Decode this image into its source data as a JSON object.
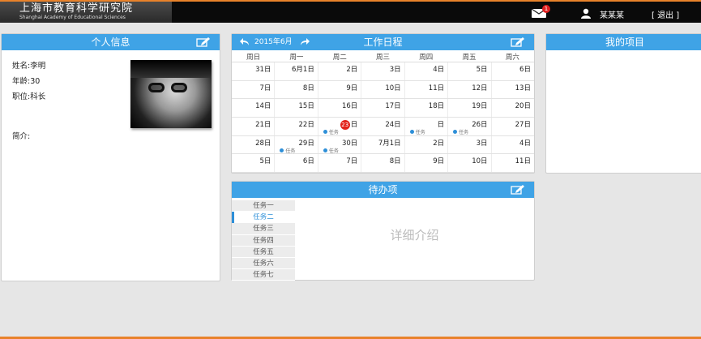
{
  "header": {
    "logo_cn": "上海市教育科学研究院",
    "logo_en": "Shanghai Academy of Educational Sciences",
    "mail_count": "1",
    "user_name": "某某某",
    "logout": "[ 退出 ]"
  },
  "info": {
    "title": "个人信息",
    "name": "姓名:李明",
    "age": "年龄:30",
    "position": "职位:科长",
    "intro": "简介:"
  },
  "calendar": {
    "title": "工作日程",
    "month": "2015年6月",
    "weekdays": [
      "周日",
      "周一",
      "周二",
      "周三",
      "周四",
      "周五",
      "周六"
    ],
    "rows": [
      [
        "31日",
        "6月1日",
        "2日",
        "3日",
        "4日",
        "5日",
        "6日"
      ],
      [
        "7日",
        "8日",
        "9日",
        "10日",
        "11日",
        "12日",
        "13日"
      ],
      [
        "14日",
        "15日",
        "16日",
        "17日",
        "18日",
        "19日",
        "20日"
      ],
      [
        "21日",
        "22日",
        "日",
        "24日",
        "日",
        "26日",
        "27日"
      ],
      [
        "28日",
        "29日",
        "30日",
        "7月1日",
        "2日",
        "3日",
        "4日"
      ],
      [
        "5日",
        "6日",
        "7日",
        "8日",
        "9日",
        "10日",
        "11日"
      ]
    ],
    "today": "23",
    "task_label": "任务",
    "accent": "#3fa3e6",
    "today_color": "#e2231a"
  },
  "todo": {
    "title": "待办项",
    "items": [
      "任务一",
      "任务二",
      "任务三",
      "任务四",
      "任务五",
      "任务六",
      "任务七"
    ],
    "active_index": 1,
    "detail": "详细介绍"
  },
  "project": {
    "title": "我的项目"
  },
  "icons": {
    "mail": "mail-icon",
    "user": "user-icon",
    "edit": "edit-icon",
    "prev": "undo-arrow-icon",
    "next": "redo-arrow-icon"
  }
}
